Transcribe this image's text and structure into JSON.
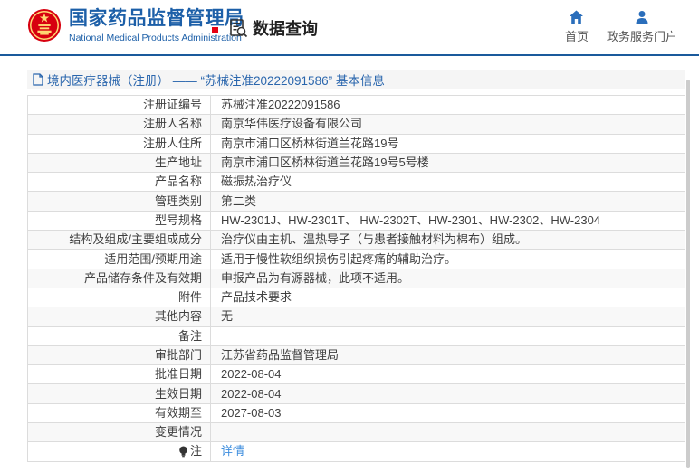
{
  "header": {
    "org_title": "国家药品监督管理局",
    "org_subtitle": "National Medical Products Administration",
    "data_query_label": "数据查询",
    "nav_home_label": "首页",
    "nav_portal_label": "政务服务门户"
  },
  "breadcrumb": {
    "text": "境内医疗器械（注册） —— “苏械注准20222091586” 基本信息"
  },
  "table": {
    "rows": [
      {
        "label": "注册证编号",
        "value": "苏械注准20222091586"
      },
      {
        "label": "注册人名称",
        "value": "南京华伟医疗设备有限公司"
      },
      {
        "label": "注册人住所",
        "value": "南京市浦口区桥林街道兰花路19号"
      },
      {
        "label": "生产地址",
        "value": "南京市浦口区桥林街道兰花路19号5号楼"
      },
      {
        "label": "产品名称",
        "value": "磁振热治疗仪"
      },
      {
        "label": "管理类别",
        "value": "第二类"
      },
      {
        "label": "型号规格",
        "value": "HW-2301J、HW-2301T、 HW-2302T、HW-2301、HW-2302、HW-2304"
      },
      {
        "label": "结构及组成/主要组成成分",
        "value": "治疗仪由主机、温热导子（与患者接触材料为棉布）组成。"
      },
      {
        "label": "适用范围/预期用途",
        "value": "适用于慢性软组织损伤引起疼痛的辅助治疗。"
      },
      {
        "label": "产品储存条件及有效期",
        "value": "申报产品为有源器械，此项不适用。"
      },
      {
        "label": "附件",
        "value": "产品技术要求"
      },
      {
        "label": "其他内容",
        "value": "无"
      },
      {
        "label": "备注",
        "value": ""
      },
      {
        "label": "审批部门",
        "value": "江苏省药品监督管理局"
      },
      {
        "label": "批准日期",
        "value": "2022-08-04"
      },
      {
        "label": "生效日期",
        "value": "2022-08-04"
      },
      {
        "label": "有效期至",
        "value": "2027-08-03"
      },
      {
        "label": "变更情况",
        "value": ""
      },
      {
        "label": "注",
        "value": "详情",
        "value_is_link": true,
        "label_icon": "bulb-note-icon"
      }
    ]
  },
  "icons": {
    "national-emblem": "red circle with golden stars",
    "doc-search-icon": "document with magnifier",
    "home-icon": "house",
    "portal-user-icon": "person",
    "file-icon": "blue document with folded corner",
    "bulb-note-icon": "dark lightbulb"
  },
  "colors": {
    "brand_blue": "#1c5fa8",
    "nav_icon_blue": "#2a6ebb",
    "link_blue": "#3e8ede",
    "divider_blue": "#1a5a9c",
    "emblem_red": "#d7000f",
    "emblem_gold": "#ffd873",
    "red_mark": "#e60012",
    "breadcrumb_bg": "#f5f5f5",
    "row_alt_bg": "#f8f8f8",
    "border_gray": "#dcdcdc"
  }
}
